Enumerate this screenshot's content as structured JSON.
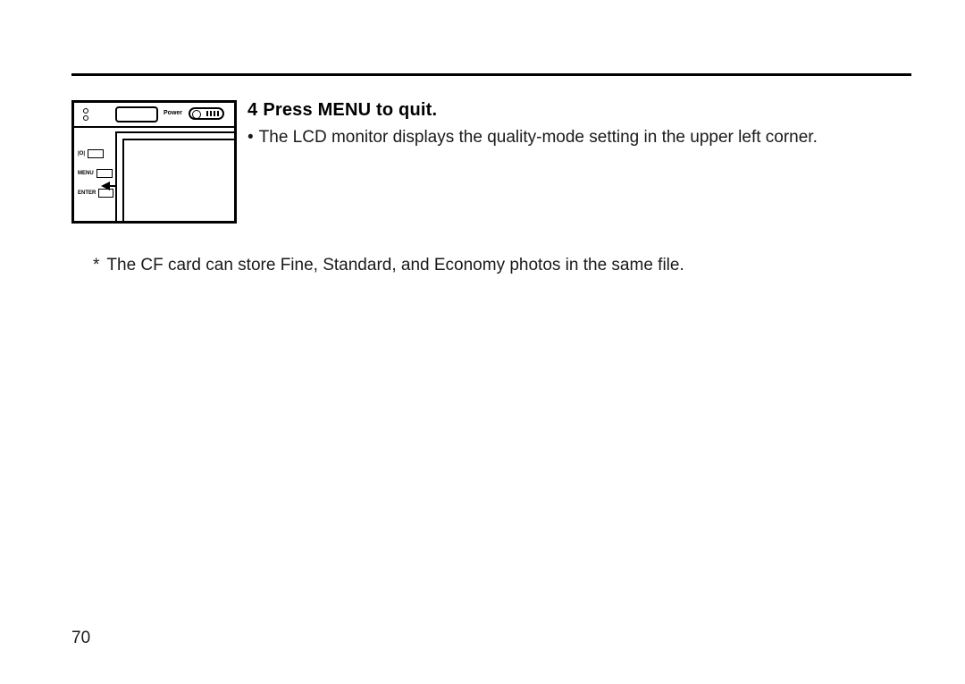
{
  "step": {
    "number": "4",
    "title": "Press MENU to quit.",
    "bullet": "The LCD monitor displays the quality-mode setting in the upper left corner."
  },
  "thumb": {
    "power_label": "Power",
    "btn1_label": "|O|",
    "btn2_label": "MENU",
    "btn3_label": "ENTER"
  },
  "footnote": {
    "marker": "*",
    "text": "The CF card can store Fine, Standard, and Economy photos in the same file."
  },
  "page_number": "70"
}
